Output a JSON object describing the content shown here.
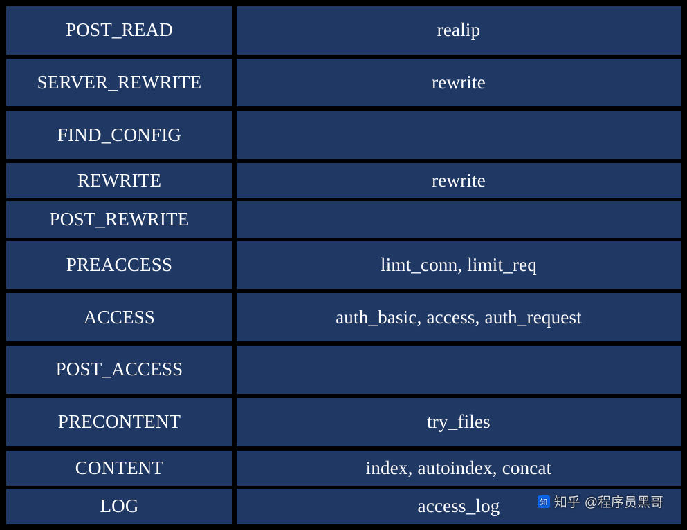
{
  "rows": [
    {
      "phase": "POST_READ",
      "module": "realip"
    },
    {
      "phase": "SERVER_REWRITE",
      "module": "rewrite"
    },
    {
      "phase": "FIND_CONFIG",
      "module": ""
    },
    {
      "phase": "REWRITE",
      "module": "rewrite"
    },
    {
      "phase": "POST_REWRITE",
      "module": ""
    },
    {
      "phase": "PREACCESS",
      "module": "limt_conn, limit_req"
    },
    {
      "phase": "ACCESS",
      "module": "auth_basic, access, auth_request"
    },
    {
      "phase": "POST_ACCESS",
      "module": ""
    },
    {
      "phase": "PRECONTENT",
      "module": "try_files"
    },
    {
      "phase": "CONTENT",
      "module": "index, autoindex, concat"
    },
    {
      "phase": "LOG",
      "module": "access_log"
    }
  ],
  "watermark": {
    "site": "知乎",
    "author": "@程序员黑哥"
  }
}
